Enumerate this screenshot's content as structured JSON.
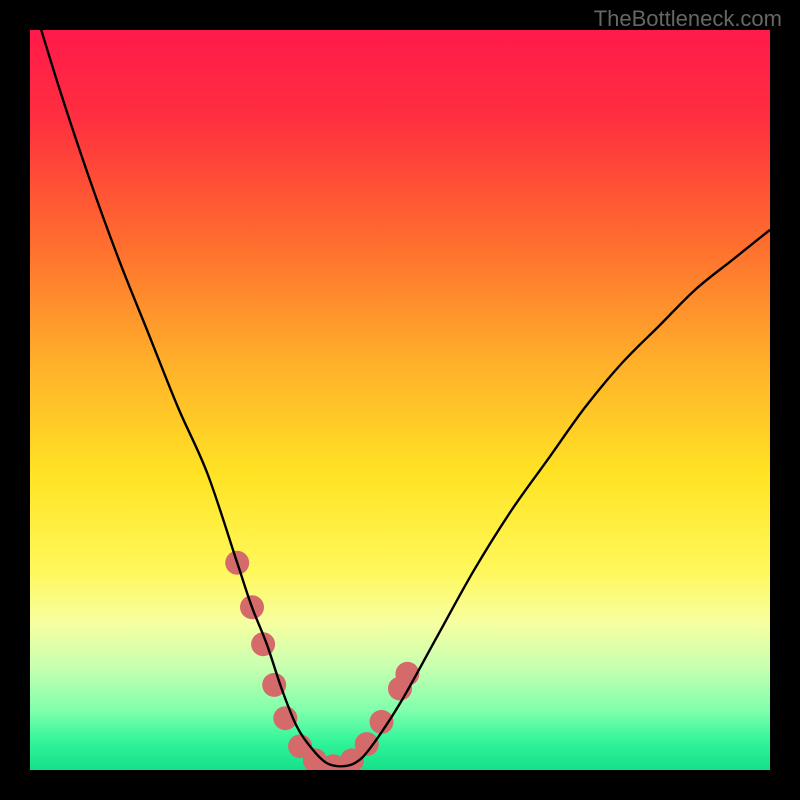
{
  "watermark": "TheBottleneck.com",
  "chart_data": {
    "type": "line",
    "title": "",
    "xlabel": "",
    "ylabel": "",
    "xlim": [
      0,
      100
    ],
    "ylim": [
      0,
      100
    ],
    "gradient_stops": [
      {
        "offset": 0,
        "color": "#ff1a4a"
      },
      {
        "offset": 12,
        "color": "#ff2f3f"
      },
      {
        "offset": 28,
        "color": "#ff6a2f"
      },
      {
        "offset": 45,
        "color": "#ffb02a"
      },
      {
        "offset": 60,
        "color": "#ffe324"
      },
      {
        "offset": 73,
        "color": "#fff85a"
      },
      {
        "offset": 80,
        "color": "#f7ffa0"
      },
      {
        "offset": 86,
        "color": "#c8ffb0"
      },
      {
        "offset": 92,
        "color": "#7fffac"
      },
      {
        "offset": 96,
        "color": "#34f59a"
      },
      {
        "offset": 100,
        "color": "#14e089"
      }
    ],
    "series": [
      {
        "name": "bottleneck-curve",
        "x": [
          0,
          4,
          8,
          12,
          16,
          20,
          24,
          28,
          30,
          32,
          34,
          36,
          38,
          40,
          42,
          44,
          46,
          50,
          55,
          60,
          65,
          70,
          75,
          80,
          85,
          90,
          95,
          100
        ],
        "y": [
          105,
          92,
          80,
          69,
          59,
          49,
          40,
          28,
          22,
          17,
          11,
          6,
          3,
          1,
          0.5,
          1,
          3,
          9,
          18,
          27,
          35,
          42,
          49,
          55,
          60,
          65,
          69,
          73
        ]
      }
    ],
    "markers": [
      {
        "x": 28.0,
        "y": 28.0
      },
      {
        "x": 30.0,
        "y": 22.0
      },
      {
        "x": 31.5,
        "y": 17.0
      },
      {
        "x": 33.0,
        "y": 11.5
      },
      {
        "x": 34.5,
        "y": 7.0
      },
      {
        "x": 36.5,
        "y": 3.2
      },
      {
        "x": 38.5,
        "y": 1.3
      },
      {
        "x": 41.0,
        "y": 0.5
      },
      {
        "x": 43.5,
        "y": 1.3
      },
      {
        "x": 45.5,
        "y": 3.5
      },
      {
        "x": 47.5,
        "y": 6.5
      },
      {
        "x": 50.0,
        "y": 11.0
      },
      {
        "x": 51.0,
        "y": 13.0
      }
    ],
    "marker_style": {
      "fill": "#d56a6a",
      "radius": 12
    },
    "curve_style": {
      "stroke": "#000000",
      "width": 2.4
    }
  }
}
